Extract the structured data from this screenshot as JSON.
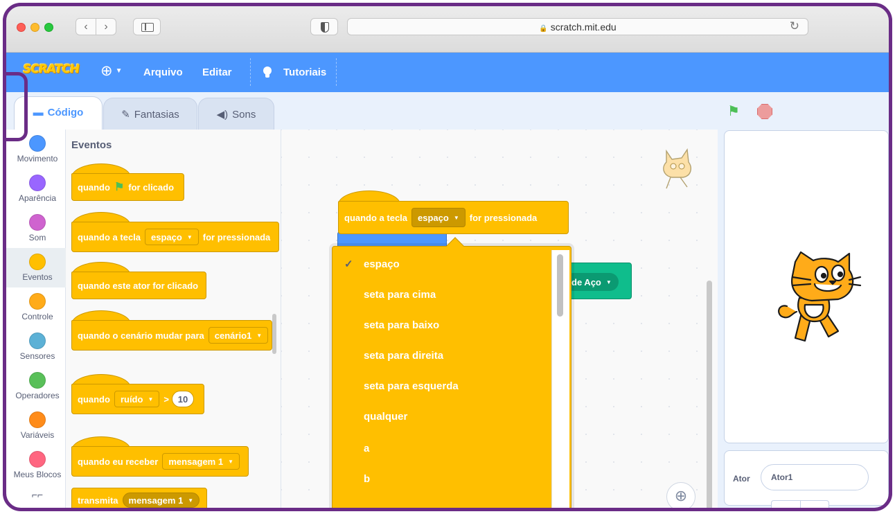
{
  "browser": {
    "nav_back": "‹",
    "nav_forward": "›",
    "url": "scratch.mit.edu",
    "reload": "↻"
  },
  "menubar": {
    "logo": "SCRATCH",
    "file": "Arquivo",
    "edit": "Editar",
    "tutorials": "Tutoriais",
    "accent_color": "#4c97ff"
  },
  "tabs": {
    "code": "Código",
    "costumes": "Fantasias",
    "sounds": "Sons"
  },
  "categories": [
    {
      "label": "Movimento",
      "color": "#4c97ff"
    },
    {
      "label": "Aparência",
      "color": "#9966ff"
    },
    {
      "label": "Som",
      "color": "#cf63cf"
    },
    {
      "label": "Eventos",
      "color": "#ffbf00"
    },
    {
      "label": "Controle",
      "color": "#ffab19"
    },
    {
      "label": "Sensores",
      "color": "#5cb1d6"
    },
    {
      "label": "Operadores",
      "color": "#59c059"
    },
    {
      "label": "Variáveis",
      "color": "#ff8c1a"
    },
    {
      "label": "Meus Blocos",
      "color": "#ff6680"
    }
  ],
  "palette": {
    "title": "Eventos",
    "flag_block": {
      "pre": "quando",
      "post": "for clicado"
    },
    "key_block": {
      "pre": "quando a tecla",
      "key": "espaço",
      "post": "for pressionada"
    },
    "sprite_click_block": "quando este ator for clicado",
    "backdrop_block": {
      "pre": "quando o cenário mudar para",
      "value": "cenário1"
    },
    "loudness_block": {
      "pre": "quando",
      "sensor": "ruído",
      "op": ">",
      "value": "10"
    },
    "receive_block": {
      "pre": "quando eu receber",
      "value": "mensagem 1"
    },
    "broadcast_block": {
      "pre": "transmita",
      "value": "mensagem 1"
    }
  },
  "script": {
    "key_block": {
      "pre": "quando a tecla",
      "key": "espaço",
      "post": "for pressionada"
    },
    "green_block_text": "de Aço"
  },
  "dropdown": {
    "selected": "espaço",
    "check": "✓",
    "items": [
      "espaço",
      "seta para cima",
      "seta para baixo",
      "seta para direita",
      "seta para esquerda",
      "qualquer",
      "a",
      "b"
    ]
  },
  "sprite_panel": {
    "label": "Ator",
    "name": "Ator1"
  },
  "zoom_icon": "⊕"
}
